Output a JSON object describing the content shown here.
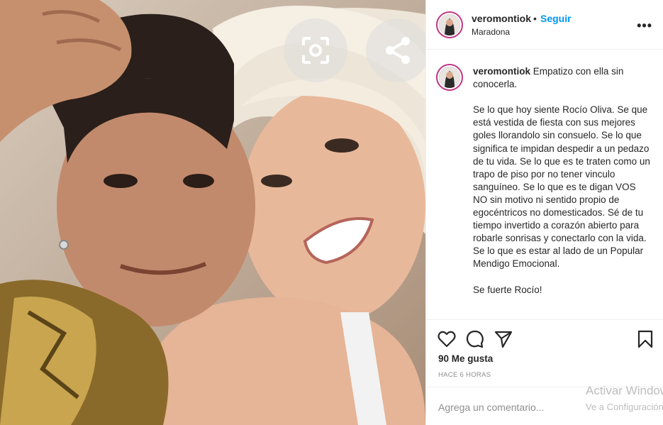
{
  "post": {
    "username": "veromontiok",
    "follow_separator": "•",
    "follow_label": "Seguir",
    "location": "Maradona",
    "more_label": "•••"
  },
  "caption": {
    "username": "veromontiok",
    "text": " Empatizo con ella sin conocerla.\n\nSe lo que hoy siente Rocío Oliva. Se que está vestida de fiesta con sus mejores goles llorandolo sin consuelo. Se lo que significa te impidan despedir a un pedazo de tu vida. Se lo que es te traten como un trapo de piso por no tener vinculo sanguíneo. Se lo que es te digan VOS NO sin motivo ni sentido propio de egocéntricos no domesticados. Sé de tu tiempo invertido a corazón abierto para robarle sonrisas y conectarlo con la vida.\nSe lo que es estar al lado de un Popular Mendigo Emocional.\n\nSe fuerte Rocío!"
  },
  "stats": {
    "likes": "90 Me gusta",
    "time": "HACE 6 HORAS"
  },
  "comment": {
    "placeholder": "Agrega un comentario..."
  },
  "icons": {
    "visual_search": "visual-search-icon",
    "share": "share-icon",
    "like": "heart-icon",
    "comment": "comment-icon",
    "send": "send-icon",
    "save": "bookmark-icon"
  },
  "watermark": {
    "line1": "Activar Windows",
    "line2": "Ve a Configuración"
  },
  "colors": {
    "follow": "#0095f6",
    "muted": "#8e8e8e",
    "avatar_ring": "#c13584"
  }
}
